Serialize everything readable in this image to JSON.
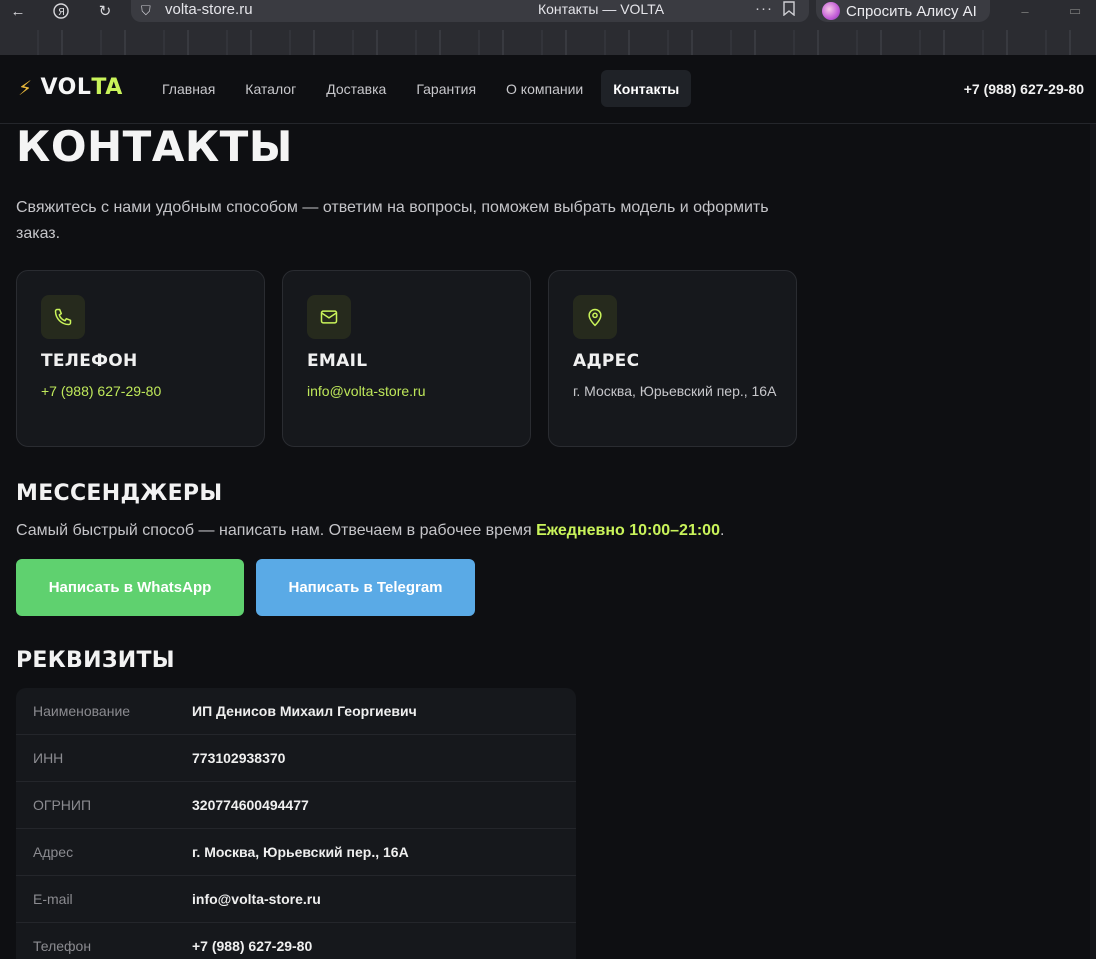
{
  "browser": {
    "url": "volta-store.ru",
    "tab_title": "Контакты — VOLTA",
    "alice_label": "Спросить Алису AI"
  },
  "header": {
    "logo_vol": "VOL",
    "logo_ta": "TA",
    "nav": [
      "Главная",
      "Каталог",
      "Доставка",
      "Гарантия",
      "О компании",
      "Контакты"
    ],
    "active_nav": "Контакты",
    "phone": "+7 (988) 627-29-80"
  },
  "main": {
    "title": "КОНТАКТЫ",
    "intro": "Свяжитесь с нами удобным способом — ответим на вопросы, поможем выбрать модель и оформить заказ.",
    "cards": [
      {
        "icon": "phone-icon",
        "title": "ТЕЛЕФОН",
        "value": "+7 (988) 627-29-80"
      },
      {
        "icon": "mail-icon",
        "title": "EMAIL",
        "value": "info@volta-store.ru"
      },
      {
        "icon": "map-pin-icon",
        "title": "АДРЕС",
        "value": "г. Москва, Юрьевский пер., 16А"
      }
    ],
    "messengers": {
      "title": "МЕССЕНДЖЕРЫ",
      "text": "Самый быстрый способ — написать нам. Отвечаем в рабочее время ",
      "hours": "Ежедневно 10:00–21:00",
      "text_end": ".",
      "whatsapp_label": "Написать в WhatsApp",
      "telegram_label": "Написать в Telegram"
    },
    "requisites": {
      "title": "РЕКВИЗИТЫ",
      "rows": [
        {
          "label": "Наименование",
          "value": "ИП Денисов Михаил Георгиевич"
        },
        {
          "label": "ИНН",
          "value": "773102938370"
        },
        {
          "label": "ОГРНИП",
          "value": "320774600494477"
        },
        {
          "label": "Адрес",
          "value": "г. Москва, Юрьевский пер., 16А"
        },
        {
          "label": "E-mail",
          "value": "info@volta-store.ru"
        },
        {
          "label": "Телефон",
          "value": "+7 (988) 627-29-80"
        }
      ]
    }
  },
  "colors": {
    "accent": "#c9f35a",
    "background": "#0e0f12",
    "whatsapp": "#5fd16f",
    "telegram": "#5aaae6"
  }
}
